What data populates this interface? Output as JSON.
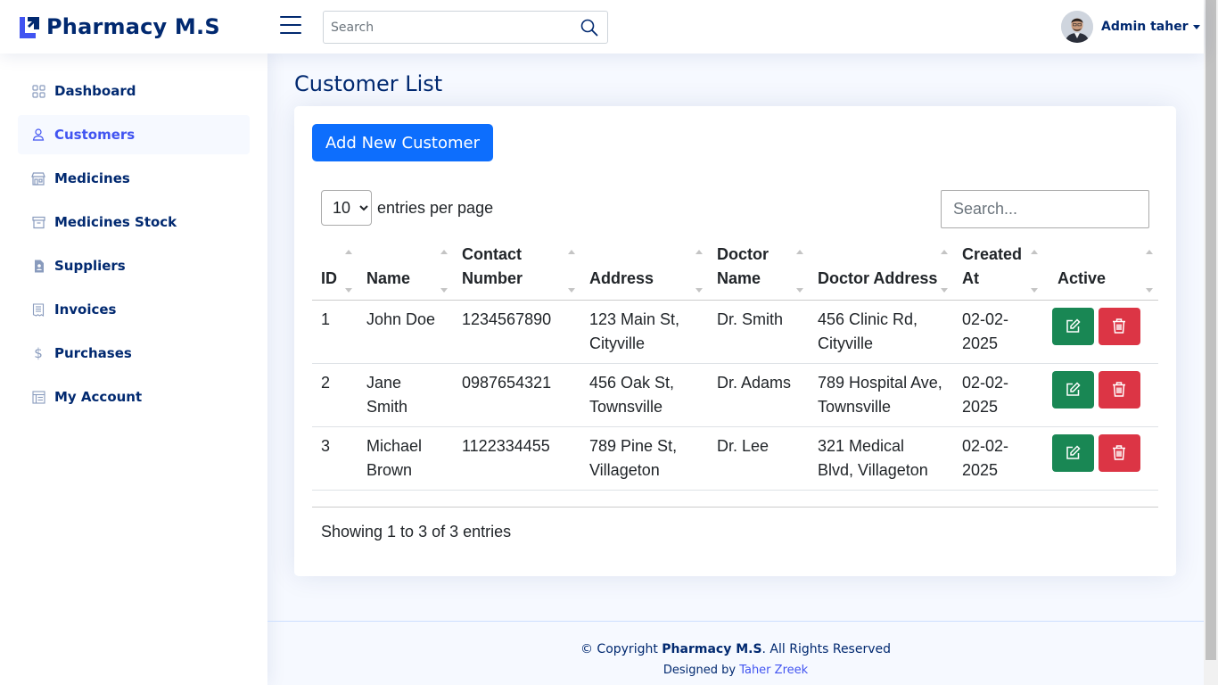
{
  "app": {
    "title": "Pharmacy M.S"
  },
  "header": {
    "search_placeholder": "Search",
    "user_name": "Admin taher"
  },
  "sidebar": {
    "items": [
      {
        "label": "Dashboard",
        "icon": "grid-icon",
        "active": false
      },
      {
        "label": "Customers",
        "icon": "person-icon",
        "active": true
      },
      {
        "label": "Medicines",
        "icon": "shop-icon",
        "active": false
      },
      {
        "label": "Medicines Stock",
        "icon": "archive-icon",
        "active": false
      },
      {
        "label": "Suppliers",
        "icon": "person-badge-icon",
        "active": false
      },
      {
        "label": "Invoices",
        "icon": "receipt-icon",
        "active": false
      },
      {
        "label": "Purchases",
        "icon": "dollar-icon",
        "active": false
      },
      {
        "label": "My Account",
        "icon": "layout-icon",
        "active": false
      }
    ]
  },
  "page": {
    "title": "Customer List",
    "add_button": "Add New Customer",
    "entries_value": "10",
    "entries_label": "entries per page",
    "table_search_placeholder": "Search...",
    "showing": "Showing 1 to 3 of 3 entries"
  },
  "table": {
    "columns": [
      "ID",
      "Name",
      "Contact Number",
      "Address",
      "Doctor Name",
      "Doctor Address",
      "Created At",
      "Active"
    ],
    "rows": [
      [
        "1",
        "John Doe",
        "1234567890",
        "123 Main St, Cityville",
        "Dr. Smith",
        "456 Clinic Rd, Cityville",
        "02-02-2025"
      ],
      [
        "2",
        "Jane Smith",
        "0987654321",
        "456 Oak St, Townsville",
        "Dr. Adams",
        "789 Hospital Ave, Townsville",
        "02-02-2025"
      ],
      [
        "3",
        "Michael Brown",
        "1122334455",
        "789 Pine St, Villageton",
        "Dr. Lee",
        "321 Medical Blvd, Villageton",
        "02-02-2025"
      ]
    ]
  },
  "footer": {
    "copyright_prefix": "© Copyright",
    "brand": "Pharmacy M.S",
    "copyright_suffix": ". All Rights Reserved",
    "designed_by": "Designed by",
    "designer": "Taher Zreek"
  },
  "colors": {
    "brand": "#012970",
    "accent": "#4154f1",
    "primary_button": "#0d6efd",
    "edit_button": "#198754",
    "delete_button": "#dc3545"
  }
}
